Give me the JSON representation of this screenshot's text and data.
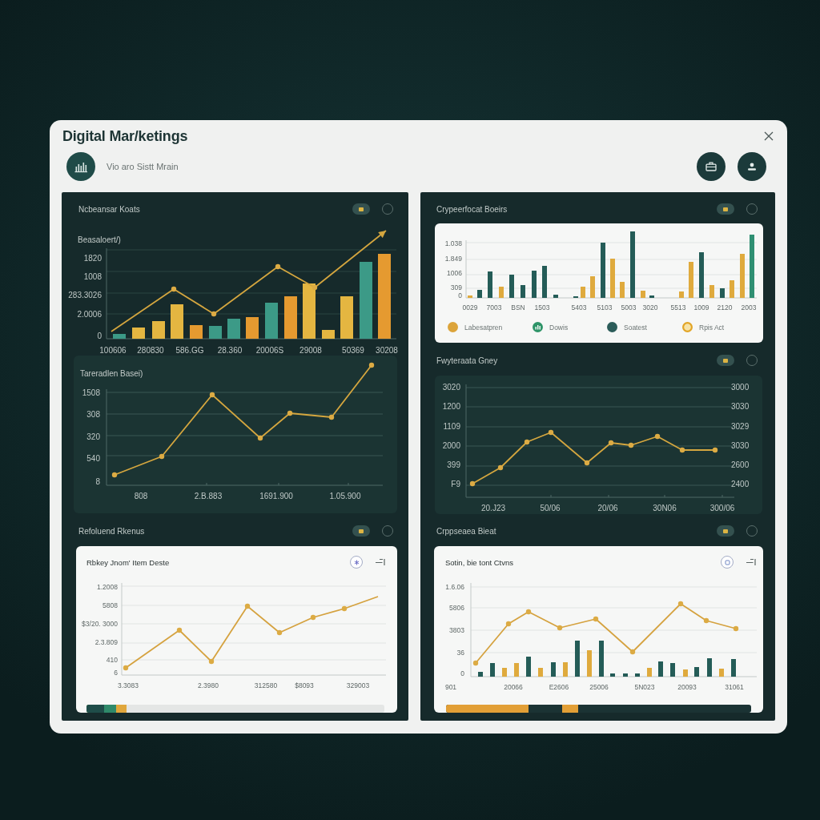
{
  "window": {
    "title": "Digital Mar/ketings",
    "subtitle": "Vio aro Sistt Mrain"
  },
  "panels": [
    {
      "sections": [
        {
          "title": "Ncbeansar Koats",
          "chart": {
            "kind": "bar_line",
            "label": "Beasaloert/)",
            "y_labels": [
              "1820",
              "1008",
              "283.3026",
              "2.0006",
              "0"
            ],
            "x_labels": [
              "100606",
              "280830",
              "586.GG",
              "28.360",
              "20006S",
              "29008",
              "50369",
              "30208"
            ]
          }
        },
        {
          "card": {
            "kind": "dark",
            "chart": {
              "kind": "line",
              "label": "Tareradlen Basei)",
              "y_labels": [
                "1508",
                "308",
                "320",
                "540",
                "8"
              ],
              "x_labels": [
                "808",
                "2.B.883",
                "1691.900",
                "1.05.900"
              ]
            }
          }
        },
        {
          "title": "Refoluend Rkenus",
          "card": {
            "kind": "light",
            "title": "Rbkey Jnom' Item Deste",
            "chart": {
              "kind": "line",
              "y_labels": [
                "1.2008",
                "5808",
                "$3/20. 3000",
                "2.3.809",
                "410",
                "6"
              ],
              "x_labels": [
                "3.3083",
                "2.3980",
                "312580",
                "$8093",
                "329003"
              ]
            },
            "strip": {
              "kind": "light",
              "segments": [
                {
                  "kind": "fill",
                  "color": "#1f4d49",
                  "level": 0.06
                },
                {
                  "kind": "fill",
                  "color": "#2f8a6a",
                  "level": 0.1
                },
                {
                  "kind": "fill",
                  "color": "#e0a73c",
                  "level": 0.135
                }
              ]
            }
          }
        }
      ]
    },
    {
      "sections": [
        {
          "title": "Crypeerfocat Boeirs",
          "card": {
            "kind": "light",
            "chart": {
              "kind": "grouped_bar",
              "y_labels": [
                "1.038",
                "1.849",
                "1006",
                "309",
                "0"
              ],
              "x_labels": [
                "0029",
                "7003",
                "BSN",
                "1503",
                "5403",
                "5103",
                "5003",
                "3020",
                "5513",
                "1009",
                "2120",
                "2003"
              ]
            },
            "legend": [
              {
                "label": "Labesatpren",
                "color": "#dca43a",
                "kind": "dot"
              },
              {
                "label": "Dowis",
                "color": "#2e9468",
                "kind": "badge"
              },
              {
                "label": "Soatest",
                "color": "#2b5c59",
                "kind": "dot"
              },
              {
                "label": "Rpis Act",
                "color": "#e2a526",
                "kind": "ring"
              }
            ]
          }
        },
        {
          "title": "Fwyteraata Gney",
          "card": {
            "kind": "dark",
            "chart": {
              "kind": "dual_line",
              "y_labels": [
                "3020",
                "1200",
                "1109",
                "2000",
                "399",
                "F9"
              ],
              "y_right_labels": [
                "3000",
                "3030",
                "3029",
                "3030",
                "2600",
                "2400"
              ],
              "x_labels": [
                "20.J23",
                "50/06",
                "20/06",
                "30N06",
                "300/06"
              ]
            }
          }
        },
        {
          "title": "Crppseaea Bieat",
          "card": {
            "kind": "light",
            "title": "Sotin, bie tont Ctvns",
            "chart": {
              "kind": "bar_line",
              "y_labels": [
                "1.6.06",
                "5806",
                "3803",
                "36",
                "0"
              ],
              "x_labels": [
                "901",
                "20066",
                "E2606",
                "25006",
                "5N023",
                "20093",
                "31061"
              ]
            },
            "strip": {
              "kind": "dark",
              "segments": [
                {
                  "kind": "fill",
                  "color": "#e29f36",
                  "level": 0.27
                },
                {
                  "kind": "thumb",
                  "color": "#e29f36",
                  "level": 0.407
                }
              ]
            }
          }
        }
      ]
    }
  ]
}
